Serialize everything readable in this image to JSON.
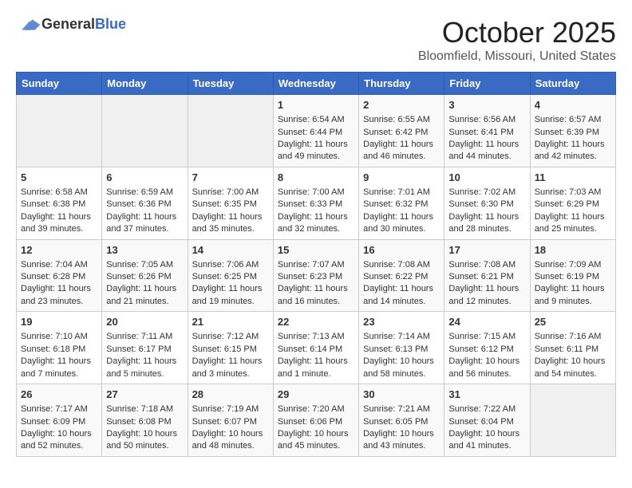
{
  "header": {
    "logo_general": "General",
    "logo_blue": "Blue",
    "month": "October 2025",
    "location": "Bloomfield, Missouri, United States"
  },
  "days_of_week": [
    "Sunday",
    "Monday",
    "Tuesday",
    "Wednesday",
    "Thursday",
    "Friday",
    "Saturday"
  ],
  "weeks": [
    [
      {
        "day": "",
        "empty": true
      },
      {
        "day": "",
        "empty": true
      },
      {
        "day": "",
        "empty": true
      },
      {
        "day": "1",
        "sunrise": "6:54 AM",
        "sunset": "6:44 PM",
        "daylight": "11 hours and 49 minutes."
      },
      {
        "day": "2",
        "sunrise": "6:55 AM",
        "sunset": "6:42 PM",
        "daylight": "11 hours and 46 minutes."
      },
      {
        "day": "3",
        "sunrise": "6:56 AM",
        "sunset": "6:41 PM",
        "daylight": "11 hours and 44 minutes."
      },
      {
        "day": "4",
        "sunrise": "6:57 AM",
        "sunset": "6:39 PM",
        "daylight": "11 hours and 42 minutes."
      }
    ],
    [
      {
        "day": "5",
        "sunrise": "6:58 AM",
        "sunset": "6:38 PM",
        "daylight": "11 hours and 39 minutes."
      },
      {
        "day": "6",
        "sunrise": "6:59 AM",
        "sunset": "6:36 PM",
        "daylight": "11 hours and 37 minutes."
      },
      {
        "day": "7",
        "sunrise": "7:00 AM",
        "sunset": "6:35 PM",
        "daylight": "11 hours and 35 minutes."
      },
      {
        "day": "8",
        "sunrise": "7:00 AM",
        "sunset": "6:33 PM",
        "daylight": "11 hours and 32 minutes."
      },
      {
        "day": "9",
        "sunrise": "7:01 AM",
        "sunset": "6:32 PM",
        "daylight": "11 hours and 30 minutes."
      },
      {
        "day": "10",
        "sunrise": "7:02 AM",
        "sunset": "6:30 PM",
        "daylight": "11 hours and 28 minutes."
      },
      {
        "day": "11",
        "sunrise": "7:03 AM",
        "sunset": "6:29 PM",
        "daylight": "11 hours and 25 minutes."
      }
    ],
    [
      {
        "day": "12",
        "sunrise": "7:04 AM",
        "sunset": "6:28 PM",
        "daylight": "11 hours and 23 minutes."
      },
      {
        "day": "13",
        "sunrise": "7:05 AM",
        "sunset": "6:26 PM",
        "daylight": "11 hours and 21 minutes."
      },
      {
        "day": "14",
        "sunrise": "7:06 AM",
        "sunset": "6:25 PM",
        "daylight": "11 hours and 19 minutes."
      },
      {
        "day": "15",
        "sunrise": "7:07 AM",
        "sunset": "6:23 PM",
        "daylight": "11 hours and 16 minutes."
      },
      {
        "day": "16",
        "sunrise": "7:08 AM",
        "sunset": "6:22 PM",
        "daylight": "11 hours and 14 minutes."
      },
      {
        "day": "17",
        "sunrise": "7:08 AM",
        "sunset": "6:21 PM",
        "daylight": "11 hours and 12 minutes."
      },
      {
        "day": "18",
        "sunrise": "7:09 AM",
        "sunset": "6:19 PM",
        "daylight": "11 hours and 9 minutes."
      }
    ],
    [
      {
        "day": "19",
        "sunrise": "7:10 AM",
        "sunset": "6:18 PM",
        "daylight": "11 hours and 7 minutes."
      },
      {
        "day": "20",
        "sunrise": "7:11 AM",
        "sunset": "6:17 PM",
        "daylight": "11 hours and 5 minutes."
      },
      {
        "day": "21",
        "sunrise": "7:12 AM",
        "sunset": "6:15 PM",
        "daylight": "11 hours and 3 minutes."
      },
      {
        "day": "22",
        "sunrise": "7:13 AM",
        "sunset": "6:14 PM",
        "daylight": "11 hours and 1 minute."
      },
      {
        "day": "23",
        "sunrise": "7:14 AM",
        "sunset": "6:13 PM",
        "daylight": "10 hours and 58 minutes."
      },
      {
        "day": "24",
        "sunrise": "7:15 AM",
        "sunset": "6:12 PM",
        "daylight": "10 hours and 56 minutes."
      },
      {
        "day": "25",
        "sunrise": "7:16 AM",
        "sunset": "6:11 PM",
        "daylight": "10 hours and 54 minutes."
      }
    ],
    [
      {
        "day": "26",
        "sunrise": "7:17 AM",
        "sunset": "6:09 PM",
        "daylight": "10 hours and 52 minutes."
      },
      {
        "day": "27",
        "sunrise": "7:18 AM",
        "sunset": "6:08 PM",
        "daylight": "10 hours and 50 minutes."
      },
      {
        "day": "28",
        "sunrise": "7:19 AM",
        "sunset": "6:07 PM",
        "daylight": "10 hours and 48 minutes."
      },
      {
        "day": "29",
        "sunrise": "7:20 AM",
        "sunset": "6:06 PM",
        "daylight": "10 hours and 45 minutes."
      },
      {
        "day": "30",
        "sunrise": "7:21 AM",
        "sunset": "6:05 PM",
        "daylight": "10 hours and 43 minutes."
      },
      {
        "day": "31",
        "sunrise": "7:22 AM",
        "sunset": "6:04 PM",
        "daylight": "10 hours and 41 minutes."
      },
      {
        "day": "",
        "empty": true
      }
    ]
  ],
  "labels": {
    "sunrise_prefix": "Sunrise: ",
    "sunset_prefix": "Sunset: ",
    "daylight_prefix": "Daylight: "
  }
}
